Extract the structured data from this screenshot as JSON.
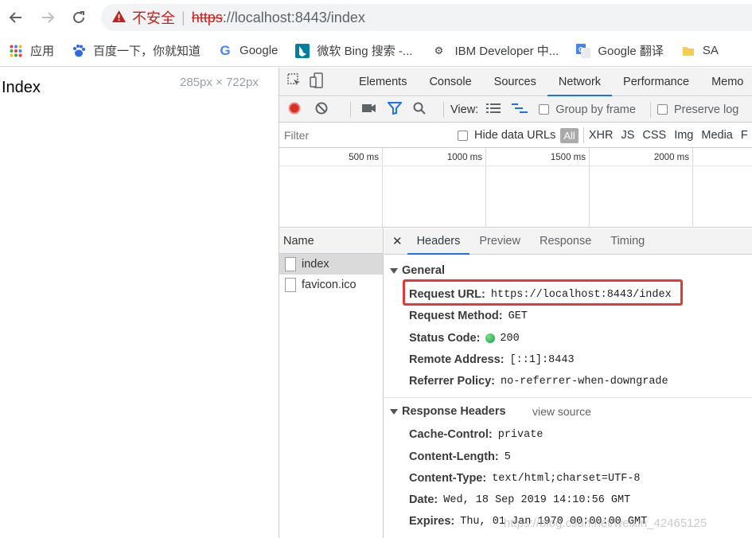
{
  "browser": {
    "security_label": "不安全",
    "url_scheme": "https",
    "url_rest": "://localhost:8443/index"
  },
  "bookmarks": [
    {
      "label": "应用",
      "icon": "apps-grid-icon"
    },
    {
      "label": "百度一下，你就知道",
      "icon": "baidu-paw-icon"
    },
    {
      "label": "Google",
      "icon": "google-g-icon"
    },
    {
      "label": "微软 Bing 搜索 -...",
      "icon": "bing-icon"
    },
    {
      "label": "IBM Developer 中...",
      "icon": "ibm-developer-icon"
    },
    {
      "label": "Google 翻译",
      "icon": "google-translate-icon"
    },
    {
      "label": "SA",
      "icon": "folder-icon"
    }
  ],
  "page": {
    "heading": "Index",
    "viewport_size": "285px × 722px"
  },
  "devtools": {
    "tabs": [
      "Elements",
      "Console",
      "Sources",
      "Network",
      "Performance",
      "Memo"
    ],
    "active_tab": "Network",
    "toolbar": {
      "view_label": "View:",
      "group_by_frame": "Group by frame",
      "preserve_log": "Preserve log"
    },
    "filter": {
      "placeholder": "Filter",
      "hide_data_urls": "Hide data URLs",
      "types": [
        "All",
        "XHR",
        "JS",
        "CSS",
        "Img",
        "Media",
        "F"
      ]
    },
    "timeline_ticks": [
      "500 ms",
      "1000 ms",
      "1500 ms",
      "2000 ms"
    ],
    "name_header": "Name",
    "requests": [
      "index",
      "favicon.ico"
    ],
    "detail_tabs": [
      "Headers",
      "Preview",
      "Response",
      "Timing"
    ],
    "general": {
      "title": "General",
      "rows": [
        {
          "key": "Request URL:",
          "value": "https://localhost:8443/index"
        },
        {
          "key": "Request Method:",
          "value": "GET"
        },
        {
          "key": "Status Code:",
          "value": "200"
        },
        {
          "key": "Remote Address:",
          "value": "[::1]:8443"
        },
        {
          "key": "Referrer Policy:",
          "value": "no-referrer-when-downgrade"
        }
      ]
    },
    "response_headers": {
      "title": "Response Headers",
      "view_source": "view source",
      "rows": [
        {
          "key": "Cache-Control:",
          "value": "private"
        },
        {
          "key": "Content-Length:",
          "value": "5"
        },
        {
          "key": "Content-Type:",
          "value": "text/html;charset=UTF-8"
        },
        {
          "key": "Date:",
          "value": "Wed, 18 Sep 2019 14:10:56 GMT"
        },
        {
          "key": "Expires:",
          "value": "Thu, 01 Jan 1970 00:00:00 GMT"
        }
      ]
    },
    "watermark": "https://blog.csdn.net/weixin_42465125"
  },
  "colors": {
    "accent": "#1a73e8",
    "insecure": "#c5221f",
    "record": "#d93025",
    "status_ok": "#0f9d58",
    "highlight_box": "#e53935"
  }
}
